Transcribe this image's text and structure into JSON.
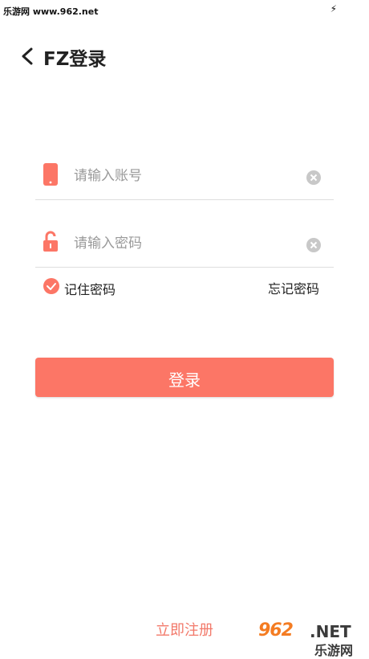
{
  "status_bar": {
    "text": "乐游网 www.962.net",
    "bolt": "⚡"
  },
  "header": {
    "title": "FZ登录",
    "back_icon": "chevron-left-icon"
  },
  "form": {
    "account": {
      "placeholder": "请输入账号",
      "value": "",
      "icon": "phone-icon"
    },
    "password": {
      "placeholder": "请输入密码",
      "value": "",
      "icon": "lock-open-icon"
    },
    "remember_label": "记住密码",
    "remember_checked": true,
    "forgot_label": "忘记密码",
    "login_label": "登录"
  },
  "footer": {
    "register_label": "立即注册"
  },
  "watermark": {
    "logo": "962",
    "suffix": ".NET",
    "cn": "乐游网"
  },
  "colors": {
    "accent": "#fc7666",
    "register": "#f2796a",
    "clear": "#c8c8c8"
  }
}
